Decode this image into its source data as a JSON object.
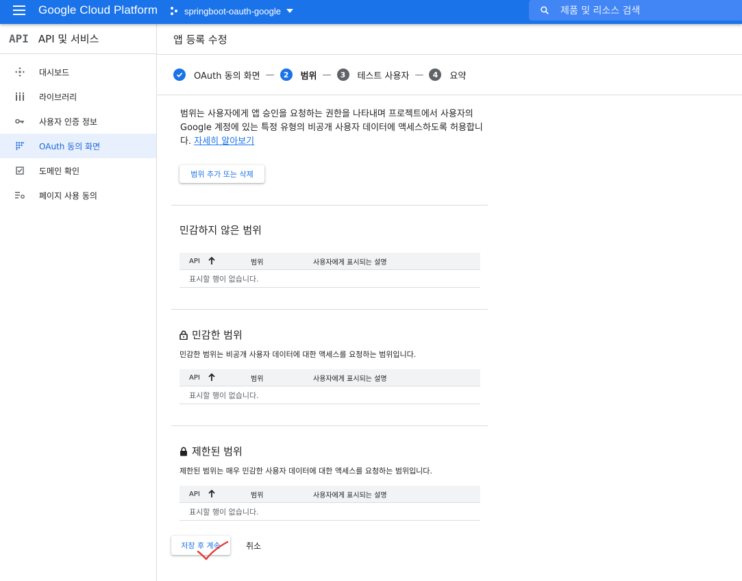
{
  "topbar": {
    "brand": "Google Cloud Platform",
    "project_name": "springboot-oauth-google",
    "search_placeholder": "제품 및 리소스 검색"
  },
  "sidebar": {
    "logo": "API",
    "title": "API 및 서비스",
    "items": [
      {
        "label": "대시보드",
        "icon": "dashboard-icon",
        "active": false
      },
      {
        "label": "라이브러리",
        "icon": "library-icon",
        "active": false
      },
      {
        "label": "사용자 인증 정보",
        "icon": "key-icon",
        "active": false
      },
      {
        "label": "OAuth 동의 화면",
        "icon": "consent-dots-icon",
        "active": true
      },
      {
        "label": "도메인 확인",
        "icon": "checkbox-icon",
        "active": false
      },
      {
        "label": "페이지 사용 동의",
        "icon": "settings-list-icon",
        "active": false
      }
    ]
  },
  "main": {
    "title": "앱 등록 수정",
    "steps": [
      {
        "number": "",
        "label": "OAuth 동의 화면",
        "state": "done"
      },
      {
        "number": "2",
        "label": "범위",
        "state": "current"
      },
      {
        "number": "3",
        "label": "테스트 사용자",
        "state": "todo"
      },
      {
        "number": "4",
        "label": "요약",
        "state": "todo"
      }
    ],
    "step_separator": "—",
    "intro_text": "범위는 사용자에게 앱 승인을 요청하는 권한을 나타내며 프로젝트에서 사용자의 Google 계정에 있는 특정 유형의 비공개 사용자 데이터에 액세스하도록 허용합니다.",
    "intro_link": "자세히 알아보기",
    "add_remove_button": "범위 추가 또는 삭제",
    "sections": [
      {
        "title": "민감하지 않은 범위",
        "locked": false,
        "description": ""
      },
      {
        "title": "민감한 범위",
        "locked": true,
        "description": "민감한 범위는 비공개 사용자 데이터에 대한 액세스를 요청하는 범위입니다."
      },
      {
        "title": "제한된 범위",
        "locked": true,
        "description": "제한된 범위는 매우 민감한 사용자 데이터에 대한 액세스를 요청하는 범위입니다."
      }
    ],
    "table": {
      "col_api": "API",
      "col_scope": "범위",
      "col_description": "사용자에게 표시되는 설명",
      "empty_text": "표시할 행이 없습니다."
    },
    "save_button": "저장 후 계속",
    "cancel_button": "취소"
  },
  "colors": {
    "primary": "#1a73e8",
    "annotation_check": "#e53935"
  }
}
